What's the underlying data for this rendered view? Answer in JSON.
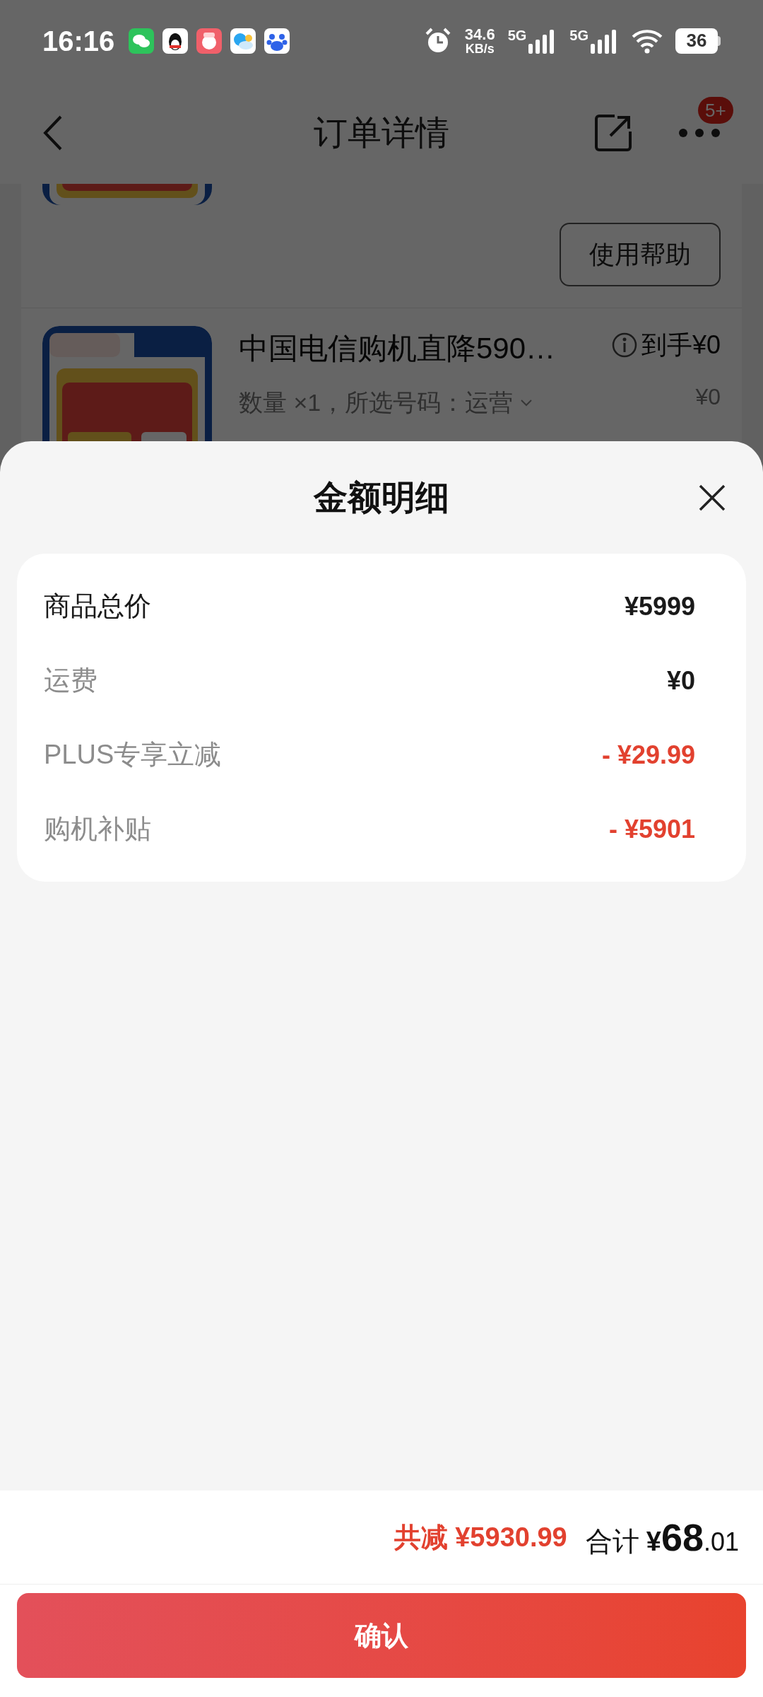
{
  "status_bar": {
    "time": "16:16",
    "speed_value": "34.6",
    "speed_unit": "KB/s",
    "signals": [
      {
        "label": "5G"
      },
      {
        "label": "5G"
      }
    ],
    "battery": "36"
  },
  "header": {
    "title": "订单详情",
    "badge": "5+"
  },
  "order": {
    "help_button": "使用帮助",
    "product": {
      "title": "中国电信购机直降590…",
      "spec": "数量 ×1，所选号码：运营",
      "price_label": "到手¥0",
      "price": "¥0"
    }
  },
  "sheet": {
    "title": "金额明细",
    "rows": [
      {
        "kind": "total",
        "label": "商品总价",
        "value": "¥5999"
      },
      {
        "kind": "fee",
        "label": "运费",
        "value": "¥0"
      },
      {
        "kind": "discount",
        "label": "PLUS专享立减",
        "value": "- ¥29.99"
      },
      {
        "kind": "discount",
        "label": "购机补贴",
        "value": "- ¥5901"
      }
    ]
  },
  "footer": {
    "saved": "共减 ¥5930.99",
    "total_label": "合计",
    "total_currency": "¥",
    "total_integer": "68",
    "total_fraction": ".01"
  },
  "confirm_button": "确认"
}
